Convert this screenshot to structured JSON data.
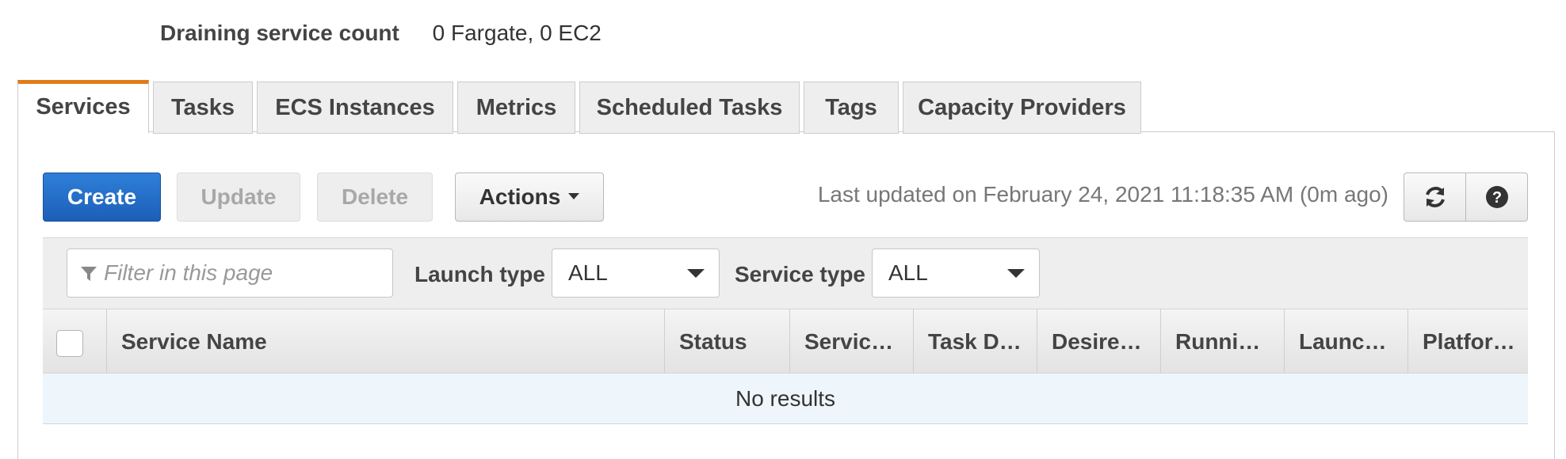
{
  "cluster_info": {
    "draining_label": "Draining service count",
    "draining_value": "0 Fargate, 0 EC2"
  },
  "tabs": [
    {
      "label": "Services",
      "active": true
    },
    {
      "label": "Tasks",
      "active": false
    },
    {
      "label": "ECS Instances",
      "active": false
    },
    {
      "label": "Metrics",
      "active": false
    },
    {
      "label": "Scheduled Tasks",
      "active": false
    },
    {
      "label": "Tags",
      "active": false
    },
    {
      "label": "Capacity Providers",
      "active": false
    }
  ],
  "toolbar": {
    "create_label": "Create",
    "update_label": "Update",
    "delete_label": "Delete",
    "actions_label": "Actions",
    "last_updated": "Last updated on February 24, 2021 11:18:35 AM (0m ago)",
    "refresh_icon": "refresh-icon",
    "help_icon": "help-icon"
  },
  "filters": {
    "search_placeholder": "Filter in this page",
    "launch_type_label": "Launch type",
    "launch_type_value": "ALL",
    "service_type_label": "Service type",
    "service_type_value": "ALL"
  },
  "table": {
    "columns": [
      "Service Name",
      "Status",
      "Servic…",
      "Task D…",
      "Desire…",
      "Runni…",
      "Launc…",
      "Platfor…"
    ],
    "empty_message": "No results"
  },
  "colors": {
    "primary": "#1b5fb8",
    "active_tab_accent": "#e07c1a",
    "empty_row_bg": "#eef6fc"
  }
}
